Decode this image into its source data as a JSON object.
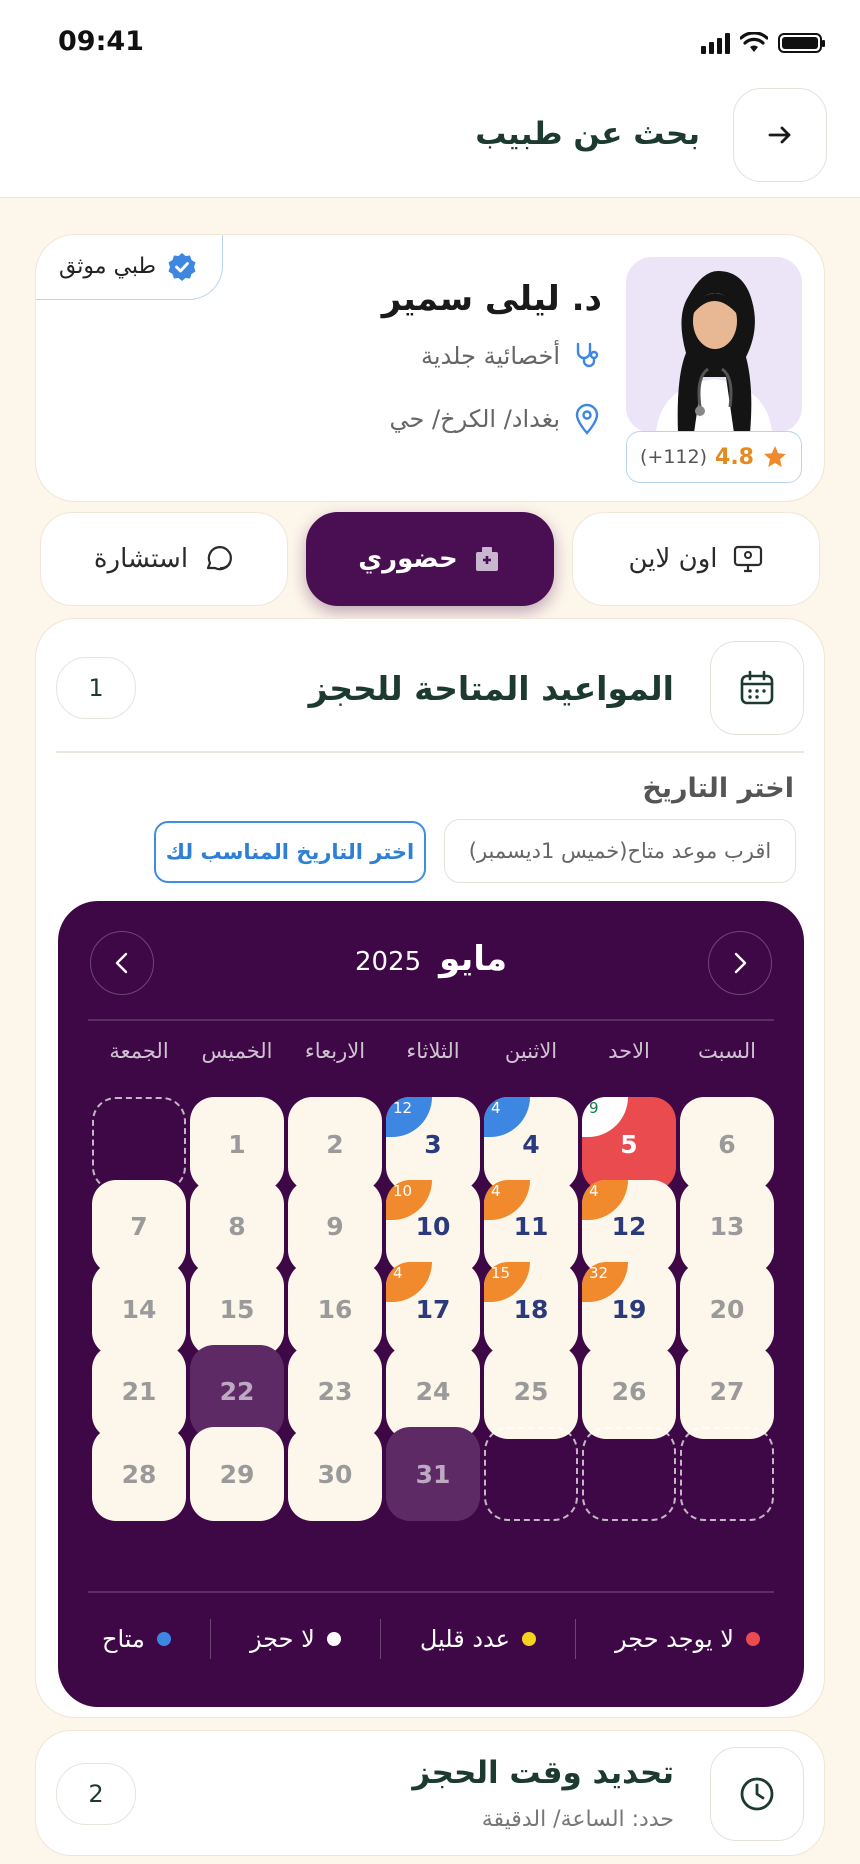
{
  "status_bar": {
    "time": "09:41"
  },
  "header": {
    "title": "بحث عن طبيب"
  },
  "doctor": {
    "verified_label": "طبي موثق",
    "name": "د. ليلى سمير",
    "specialty": "أخصائية جلدية",
    "location": "بغداد/ الكرخ/ حي",
    "rating": "4.8",
    "reviews": "(+112)"
  },
  "tabs": [
    {
      "label": "اون لاين",
      "icon": "monitor-icon",
      "active": false
    },
    {
      "label": "حضوري",
      "icon": "clinic-icon",
      "active": true
    },
    {
      "label": "استشارة",
      "icon": "chat-icon",
      "active": false
    }
  ],
  "slots": {
    "title": "المواعيد المتاحة للحجز",
    "step": "1",
    "choose_label": "اختر التاريخ",
    "nearest": "اقرب موعد متاح(خميس 1ديسمبر)",
    "pick_button": "اختر التاريخ المناسب لك"
  },
  "calendar": {
    "month": "مايو",
    "year": "2025",
    "weekdays": [
      "السبت",
      "الاحد",
      "الاثنين",
      "الثلاثاء",
      "الاربعاء",
      "الخميس",
      "الجمعة"
    ],
    "weeks": [
      [
        {
          "day": "6",
          "state": "muted"
        },
        {
          "day": "5",
          "state": "full",
          "badge": "9",
          "badge_color": "white"
        },
        {
          "day": "4",
          "state": "avail",
          "badge": "4",
          "badge_color": "blue"
        },
        {
          "day": "3",
          "state": "avail",
          "badge": "12",
          "badge_color": "blue"
        },
        {
          "day": "2",
          "state": "muted"
        },
        {
          "day": "1",
          "state": "muted"
        },
        {
          "day": "",
          "state": "empty"
        }
      ],
      [
        {
          "day": "13",
          "state": "muted"
        },
        {
          "day": "12",
          "state": "avail",
          "badge": "4",
          "badge_color": "orange"
        },
        {
          "day": "11",
          "state": "avail",
          "badge": "4",
          "badge_color": "orange"
        },
        {
          "day": "10",
          "state": "avail",
          "badge": "10",
          "badge_color": "orange"
        },
        {
          "day": "9",
          "state": "muted"
        },
        {
          "day": "8",
          "state": "muted"
        },
        {
          "day": "7",
          "state": "muted"
        }
      ],
      [
        {
          "day": "20",
          "state": "muted"
        },
        {
          "day": "19",
          "state": "avail",
          "badge": "32",
          "badge_color": "orange"
        },
        {
          "day": "18",
          "state": "avail",
          "badge": "15",
          "badge_color": "orange"
        },
        {
          "day": "17",
          "state": "avail",
          "badge": "4",
          "badge_color": "orange"
        },
        {
          "day": "16",
          "state": "muted"
        },
        {
          "day": "15",
          "state": "muted"
        },
        {
          "day": "14",
          "state": "muted"
        }
      ],
      [
        {
          "day": "27",
          "state": "muted"
        },
        {
          "day": "26",
          "state": "muted"
        },
        {
          "day": "25",
          "state": "muted"
        },
        {
          "day": "24",
          "state": "muted"
        },
        {
          "day": "23",
          "state": "muted"
        },
        {
          "day": "22",
          "state": "selected"
        },
        {
          "day": "21",
          "state": "muted"
        }
      ],
      [
        {
          "day": "",
          "state": "empty"
        },
        {
          "day": "",
          "state": "empty"
        },
        {
          "day": "",
          "state": "empty"
        },
        {
          "day": "31",
          "state": "selected"
        },
        {
          "day": "30",
          "state": "muted"
        },
        {
          "day": "29",
          "state": "muted"
        },
        {
          "day": "28",
          "state": "muted"
        }
      ]
    ],
    "legend": [
      {
        "label": "لا يوجد حجر",
        "color": "#ea4b4f"
      },
      {
        "label": "عدد قليل",
        "color": "#f5d21c"
      },
      {
        "label": "لا حجز",
        "color": "#ffffff"
      },
      {
        "label": "متاح",
        "color": "#3d87e3"
      }
    ]
  },
  "time_section": {
    "title": "تحديد وقت الحجز",
    "subtitle": "حدد: الساعة/ الدقيقة",
    "step": "2"
  },
  "colors": {
    "primary": "#4a0e52",
    "calendar_bg": "#3d0845",
    "accent_blue": "#3d87e3",
    "accent_orange": "#f08a2c",
    "full_red": "#ea4b4f"
  }
}
